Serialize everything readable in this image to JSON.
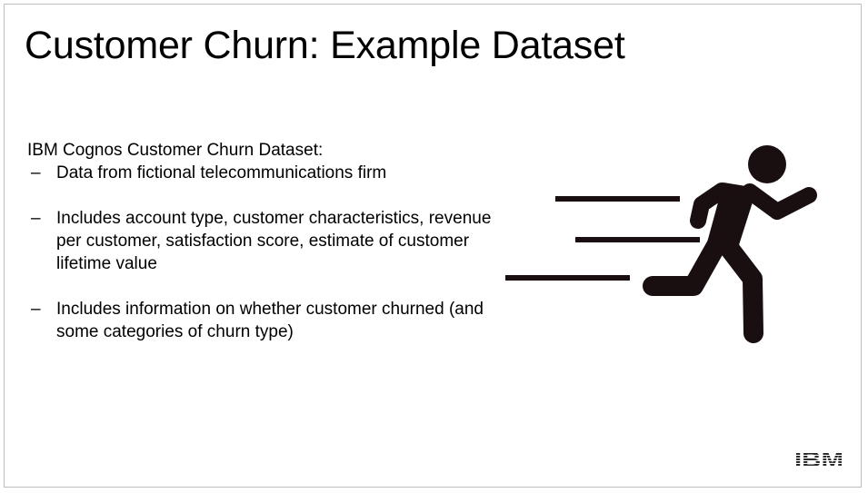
{
  "slide": {
    "title": "Customer Churn: Example Dataset",
    "lead": "IBM Cognos Customer Churn Dataset:",
    "bullets": [
      {
        "marker": "–",
        "text": "Data from fictional telecommunications firm"
      },
      {
        "marker": "–",
        "text": "Includes account type, customer characteristics, revenue per customer, satisfaction score, estimate of customer lifetime value"
      },
      {
        "marker": "–",
        "text": "Includes information on whether customer churned (and some categories of churn type)"
      }
    ],
    "illustration": {
      "icon": "running-person-icon",
      "color": "#1a0f10"
    },
    "logo": {
      "text": "IBM",
      "icon": "ibm-logo-icon"
    }
  }
}
